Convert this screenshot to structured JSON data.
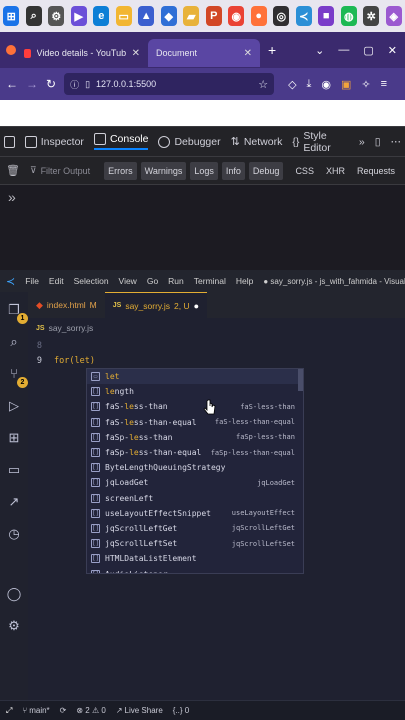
{
  "taskbar": {
    "icons": [
      {
        "name": "windows-icon",
        "color": "#1a73e8",
        "glyph": "⊞"
      },
      {
        "name": "search-icon",
        "color": "#333333",
        "glyph": "⌕"
      },
      {
        "name": "settings-icon",
        "color": "#555555",
        "glyph": "⚙"
      },
      {
        "name": "media-icon",
        "color": "#6b4fd8",
        "glyph": "▶"
      },
      {
        "name": "edge-icon",
        "color": "#0d7fd6",
        "glyph": "e"
      },
      {
        "name": "explorer-icon",
        "color": "#f2b632",
        "glyph": "▭"
      },
      {
        "name": "photos-icon",
        "color": "#3b5fcf",
        "glyph": "▲"
      },
      {
        "name": "store-icon",
        "color": "#2f6fd6",
        "glyph": "◆"
      },
      {
        "name": "folder-icon",
        "color": "#e8b23a",
        "glyph": "▰"
      },
      {
        "name": "ppt-icon",
        "color": "#d24726",
        "glyph": "P"
      },
      {
        "name": "chrome-icon",
        "color": "#ea4335",
        "glyph": "◉"
      },
      {
        "name": "firefox-icon",
        "color": "#ff7139",
        "glyph": "●"
      },
      {
        "name": "obs-icon",
        "color": "#302e31",
        "glyph": "◎"
      },
      {
        "name": "vscode-icon",
        "color": "#2b8fd6",
        "glyph": "≺"
      },
      {
        "name": "video-icon",
        "color": "#7a3cc9",
        "glyph": "■"
      },
      {
        "name": "spotify-icon",
        "color": "#1db954",
        "glyph": "◍"
      },
      {
        "name": "settings-icon-2",
        "color": "#444444",
        "glyph": "✲"
      },
      {
        "name": "app-icon",
        "color": "#9b59d0",
        "glyph": "◈"
      }
    ]
  },
  "browser": {
    "tabs": [
      {
        "label": "Video details - YouTube Studio"
      },
      {
        "label": "Document"
      }
    ],
    "url": "127.0.0.1:5500",
    "new_tab": "+",
    "win_controls": [
      "⌄",
      "—",
      "▢",
      "✕"
    ]
  },
  "devtools": {
    "tabs": [
      "Inspector",
      "Console",
      "Debugger",
      "Network",
      "Style Editor"
    ],
    "filter_placeholder": "Filter Output",
    "filters": [
      "Errors",
      "Warnings",
      "Logs",
      "Info",
      "Debug"
    ],
    "filters_right": [
      "CSS",
      "XHR",
      "Requests"
    ],
    "prompt": "»"
  },
  "vscode": {
    "menu": [
      "File",
      "Edit",
      "Selection",
      "View",
      "Go",
      "Run",
      "Terminal",
      "Help"
    ],
    "title_right": "● say_sorry.js - js_with_fahmida - Visual Studio C",
    "tabs": [
      {
        "label": "index.html",
        "status": "M"
      },
      {
        "label": "say_sorry.js",
        "status": "2, U"
      }
    ],
    "breadcrumb": "say_sorry.js",
    "lines": [
      {
        "num": "8",
        "text": ""
      },
      {
        "num": "9",
        "text": "for(let)"
      }
    ],
    "suggestions": [
      {
        "pre": "",
        "match": "let",
        "post": "",
        "detail": "",
        "kind": "▭"
      },
      {
        "pre": "",
        "match": "le",
        "post": "ngth",
        "detail": "",
        "kind": "[]"
      },
      {
        "pre": "faS-",
        "match": "le",
        "post": "ss-than",
        "detail": "faS-less-than",
        "kind": "[]"
      },
      {
        "pre": "faS-",
        "match": "le",
        "post": "ss-than-equal",
        "detail": "faS-less-than-equal",
        "kind": "[]"
      },
      {
        "pre": "faSp-",
        "match": "le",
        "post": "ss-than",
        "detail": "faSp-less-than",
        "kind": "[]"
      },
      {
        "pre": "faSp-",
        "match": "le",
        "post": "ss-than-equal",
        "detail": "faSp-less-than-equal",
        "kind": "[]"
      },
      {
        "pre": "ByteLengthQueuingStrategy",
        "match": "",
        "post": "",
        "detail": "",
        "kind": "[]"
      },
      {
        "pre": "jqLoadGet",
        "match": "",
        "post": "",
        "detail": "jqLoadGet",
        "kind": "[]"
      },
      {
        "pre": "screenLeft",
        "match": "",
        "post": "",
        "detail": "",
        "kind": "[]"
      },
      {
        "pre": "useLayoutEffectSnippet",
        "match": "",
        "post": "",
        "detail": "useLayoutEffect",
        "kind": "[]"
      },
      {
        "pre": "jqScrollLeftGet",
        "match": "",
        "post": "",
        "detail": "jqScrollLeftGet",
        "kind": "[]"
      },
      {
        "pre": "jqScrollLeftSet",
        "match": "",
        "post": "",
        "detail": "jqScrollLeftSet",
        "kind": "[]"
      },
      {
        "pre": "HTMLDataListElement",
        "match": "",
        "post": "",
        "detail": "",
        "kind": "[]"
      },
      {
        "pre": "AudioListener",
        "match": "",
        "post": "",
        "detail": "",
        "kind": "[]"
      }
    ],
    "status": {
      "branch": "main*",
      "problems": "⊗ 2 ⚠ 0",
      "live_share": "Live Share",
      "braces": "{..} 0"
    }
  }
}
